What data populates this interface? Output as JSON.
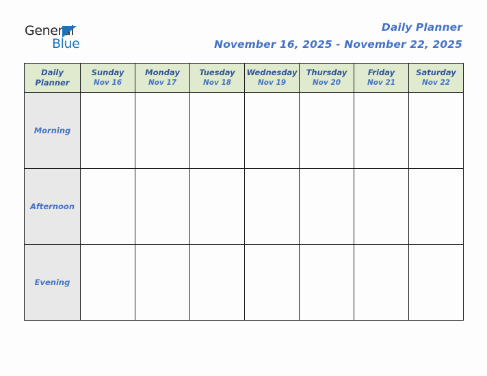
{
  "brand": {
    "name_part1": "General",
    "name_part2": "Blue",
    "logo_icon": "triangle-mark",
    "color_dark": "#231f20",
    "color_blue": "#1b74bb"
  },
  "header": {
    "title": "Daily Planner",
    "date_range": "November 16, 2025 - November 22, 2025",
    "accent_color": "#4472c4"
  },
  "table": {
    "corner": {
      "line1": "Daily",
      "line2": "Planner"
    },
    "header_background": "#dfeacf",
    "period_background": "#e8e8e8",
    "border_color": "#1a1a1a",
    "days": [
      {
        "name": "Sunday",
        "date": "Nov 16"
      },
      {
        "name": "Monday",
        "date": "Nov 17"
      },
      {
        "name": "Tuesday",
        "date": "Nov 18"
      },
      {
        "name": "Wednesday",
        "date": "Nov 19"
      },
      {
        "name": "Thursday",
        "date": "Nov 20"
      },
      {
        "name": "Friday",
        "date": "Nov 21"
      },
      {
        "name": "Saturday",
        "date": "Nov 22"
      }
    ],
    "periods": [
      {
        "label": "Morning",
        "entries": [
          "",
          "",
          "",
          "",
          "",
          "",
          ""
        ]
      },
      {
        "label": "Afternoon",
        "entries": [
          "",
          "",
          "",
          "",
          "",
          "",
          ""
        ]
      },
      {
        "label": "Evening",
        "entries": [
          "",
          "",
          "",
          "",
          "",
          "",
          ""
        ]
      }
    ]
  }
}
